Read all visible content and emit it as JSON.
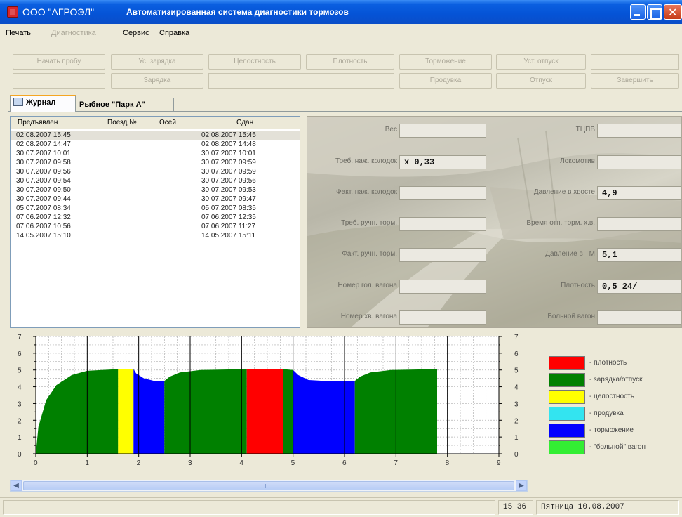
{
  "window": {
    "company": "ООО \"АГРОЭЛ\"",
    "title": "Автоматизированная система диагностики тормозов"
  },
  "menu": [
    {
      "label": "Печать",
      "enabled": true
    },
    {
      "label": "Диагностика",
      "enabled": false
    },
    {
      "label": "Сервис",
      "enabled": true
    },
    {
      "label": "Справка",
      "enabled": true
    }
  ],
  "toolbar": {
    "row1": [
      "Начать пробу",
      "Ус. зарядка",
      "Целостность",
      "Плотность",
      "Торможение",
      "Уст. отпуск"
    ],
    "row2": [
      "Зарядка",
      "Продувка",
      "Отпуск",
      "Завершить"
    ]
  },
  "tabs": [
    {
      "label": "Журнал",
      "active": true
    },
    {
      "label": "Рыбное \"Парк А\"",
      "active": false
    }
  ],
  "journal": {
    "columns": [
      "Предъявлен",
      "Поезд №",
      "Осей",
      "Сдан"
    ],
    "rows": [
      {
        "presented": "02.08.2007  15:45",
        "train": "",
        "axles": "",
        "handed": "02.08.2007  15:45"
      },
      {
        "presented": "02.08.2007  14:47",
        "train": "",
        "axles": "",
        "handed": "02.08.2007  14:48"
      },
      {
        "presented": "30.07.2007  10:01",
        "train": "",
        "axles": "",
        "handed": "30.07.2007  10:01"
      },
      {
        "presented": "30.07.2007  09:58",
        "train": "",
        "axles": "",
        "handed": "30.07.2007  09:59"
      },
      {
        "presented": "30.07.2007  09:56",
        "train": "",
        "axles": "",
        "handed": "30.07.2007  09:59"
      },
      {
        "presented": "30.07.2007  09:54",
        "train": "",
        "axles": "",
        "handed": "30.07.2007  09:56"
      },
      {
        "presented": "30.07.2007  09:50",
        "train": "",
        "axles": "",
        "handed": "30.07.2007  09:53"
      },
      {
        "presented": "30.07.2007  09:44",
        "train": "",
        "axles": "",
        "handed": "30.07.2007  09:47"
      },
      {
        "presented": "05.07.2007  08:34",
        "train": "",
        "axles": "",
        "handed": "05.07.2007  08:35"
      },
      {
        "presented": "07.06.2007  12:32",
        "train": "",
        "axles": "",
        "handed": "07.06.2007  12:35"
      },
      {
        "presented": "07.06.2007  10:56",
        "train": "",
        "axles": "",
        "handed": "07.06.2007  11:27"
      },
      {
        "presented": "14.05.2007  15:10",
        "train": "",
        "axles": "",
        "handed": "14.05.2007  15:11"
      }
    ]
  },
  "details": {
    "left": [
      {
        "label": "Вес",
        "value": ""
      },
      {
        "label": "Треб. наж. колодок",
        "value": "x 0,33"
      },
      {
        "label": "Факт. наж. колодок",
        "value": ""
      },
      {
        "label": "Треб. ручн. торм.",
        "value": ""
      },
      {
        "label": "Факт. ручн. торм.",
        "value": ""
      },
      {
        "label": "Номер гол. вагона",
        "value": ""
      },
      {
        "label": "Номер хв. вагона",
        "value": ""
      }
    ],
    "right": [
      {
        "label": "ТЦПВ",
        "value": ""
      },
      {
        "label": "Локомотив",
        "value": ""
      },
      {
        "label": "Давление в хвосте",
        "value": "4,9"
      },
      {
        "label": "Время отп. торм. х.в.",
        "value": ""
      },
      {
        "label": "Давление в ТМ",
        "value": "5,1"
      },
      {
        "label": "Плотность",
        "value": "0,5 24/"
      },
      {
        "label": "Больной вагон",
        "value": ""
      }
    ]
  },
  "chart_data": {
    "type": "area",
    "x_ticks": [
      "0",
      "1",
      "2",
      "3",
      "4",
      "5",
      "6",
      "7",
      "8",
      "9"
    ],
    "y_ticks": [
      "0",
      "1",
      "2",
      "3",
      "4",
      "5",
      "6",
      "7"
    ],
    "xlim": [
      0,
      9
    ],
    "ylim": [
      0,
      7
    ],
    "grid": true,
    "segments": [
      {
        "phase": "зарядка/отпуск",
        "x_start": 0.0,
        "x_end": 1.6,
        "y": [
          {
            "x": 0.0,
            "y": 0.0
          },
          {
            "x": 0.05,
            "y": 1.6
          },
          {
            "x": 0.2,
            "y": 3.2
          },
          {
            "x": 0.4,
            "y": 4.1
          },
          {
            "x": 0.7,
            "y": 4.7
          },
          {
            "x": 1.0,
            "y": 4.95
          },
          {
            "x": 1.6,
            "y": 5.05
          }
        ]
      },
      {
        "phase": "целостность",
        "x_start": 1.6,
        "x_end": 1.9,
        "y": [
          {
            "x": 1.6,
            "y": 5.05
          },
          {
            "x": 1.9,
            "y": 5.05
          }
        ]
      },
      {
        "phase": "торможение",
        "x_start": 1.9,
        "x_end": 2.5,
        "y": [
          {
            "x": 1.9,
            "y": 5.05
          },
          {
            "x": 1.95,
            "y": 4.8
          },
          {
            "x": 2.1,
            "y": 4.5
          },
          {
            "x": 2.3,
            "y": 4.35
          },
          {
            "x": 2.5,
            "y": 4.35
          }
        ]
      },
      {
        "phase": "зарядка/отпуск",
        "x_start": 2.5,
        "x_end": 4.1,
        "y": [
          {
            "x": 2.5,
            "y": 4.35
          },
          {
            "x": 2.6,
            "y": 4.6
          },
          {
            "x": 2.8,
            "y": 4.85
          },
          {
            "x": 3.2,
            "y": 5.0
          },
          {
            "x": 4.1,
            "y": 5.05
          }
        ]
      },
      {
        "phase": "плотность",
        "x_start": 4.1,
        "x_end": 4.8,
        "y": [
          {
            "x": 4.1,
            "y": 5.05
          },
          {
            "x": 4.8,
            "y": 5.05
          }
        ]
      },
      {
        "phase": "зарядка/отпуск",
        "x_start": 4.8,
        "x_end": 5.0,
        "y": [
          {
            "x": 4.8,
            "y": 5.05
          },
          {
            "x": 5.0,
            "y": 5.0
          }
        ]
      },
      {
        "phase": "торможение",
        "x_start": 5.0,
        "x_end": 6.2,
        "y": [
          {
            "x": 5.0,
            "y": 5.0
          },
          {
            "x": 5.1,
            "y": 4.7
          },
          {
            "x": 5.3,
            "y": 4.4
          },
          {
            "x": 5.6,
            "y": 4.35
          },
          {
            "x": 6.2,
            "y": 4.35
          }
        ]
      },
      {
        "phase": "зарядка/отпуск",
        "x_start": 6.2,
        "x_end": 7.8,
        "y": [
          {
            "x": 6.2,
            "y": 4.35
          },
          {
            "x": 6.3,
            "y": 4.6
          },
          {
            "x": 6.5,
            "y": 4.85
          },
          {
            "x": 6.9,
            "y": 5.0
          },
          {
            "x": 7.8,
            "y": 5.05
          }
        ]
      }
    ],
    "legend": [
      {
        "label": "- плотность",
        "color": "#ff0000"
      },
      {
        "label": "- зарядка/отпуск",
        "color": "#008000"
      },
      {
        "label": "- целостность",
        "color": "#ffff00"
      },
      {
        "label": "- продувка",
        "color": "#33e4f0"
      },
      {
        "label": "- торможение",
        "color": "#0000ff"
      },
      {
        "label": "- \"больной\" вагон",
        "color": "#33ee33"
      }
    ]
  },
  "status": {
    "time": "15 36",
    "date": "Пятница 10.08.2007"
  }
}
